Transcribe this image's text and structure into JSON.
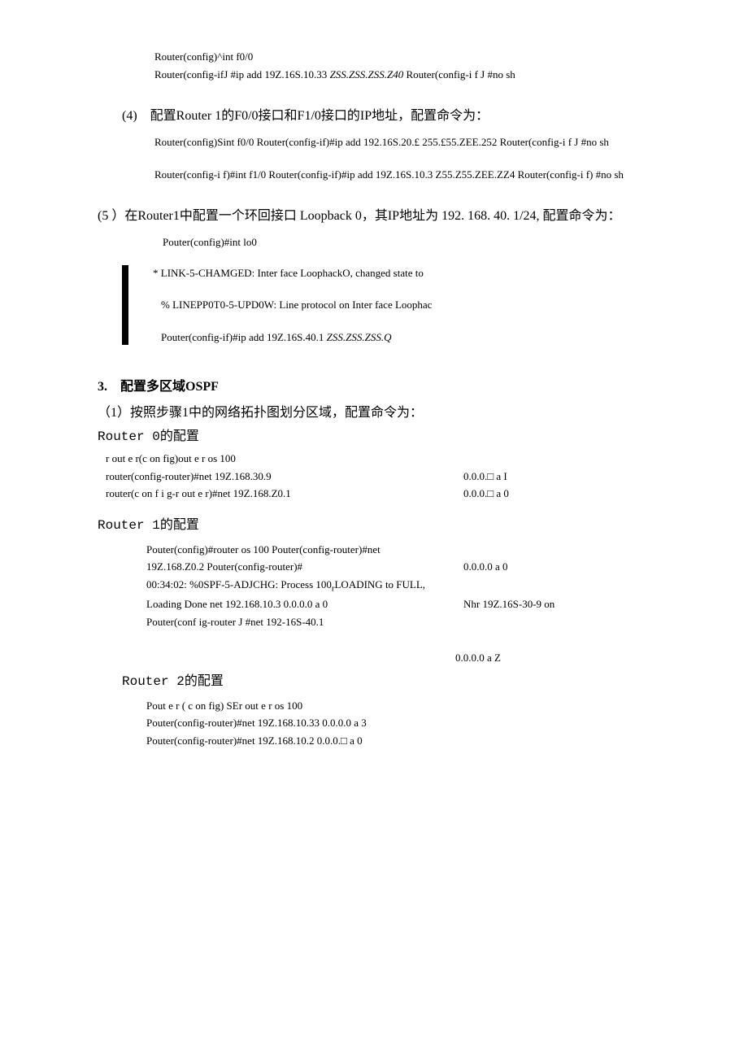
{
  "preamble": {
    "line1_a": "Router(config)^int f0/0",
    "line2_a": "Router(config-ifJ #ip add 19Z.16S.10.33 ",
    "line2_b": "ZSS.ZSS.ZSS.Z40",
    "line2_c": " Router(config-i f J #no sh"
  },
  "step4": {
    "heading": "(4)　配置Router 1的F0/0接口和F1/0接口的IP地址，配置命令为：",
    "line1": "Router(config)Sint f0/0 Router(config-if)#ip add 192.16S.20.£ 255.£55.ZEE.252 Router(config-i f J #no sh",
    "line2": "Router(config-i f)#int f1/0 Router(config-if)#ip add 19Z.16S.10.3 Z55.Z55.ZEE.ZZ4 Router(config-i f) #no sh"
  },
  "step5": {
    "heading": "(5 ）在Router1中配置一个环回接口 Loopback 0，其IP地址为 192. 168. 40. 1/24, 配置命令为：",
    "line1": "Pouter(config)#int lo0",
    "blk_line1": "* LINK-5-CHAMGED: Inter face LoophackO, changed state to",
    "blk_line2": "% LINEPP0T0-5-UPD0W: Line protocol on Inter face Loophac",
    "blk_line3_a": "Pouter(config-if)#ip add 19Z.16S.40.1 ",
    "blk_line3_b": "ZSS.ZSS.ZSS.Q"
  },
  "section3": {
    "heading": "3.　配置多区域OSPF",
    "sub1": "（1）按照步骤1中的网络拓扑图划分区域，配置命令为：",
    "r0_label": "Router 0的配置",
    "r0_line1": "r out e r(c on fig)out e r os 100",
    "r0_line2_l": "router(config-router)#net 19Z.168.30.9",
    "r0_line2_r": "0.0.0.□ a I",
    "r0_line3_l": "router(c on f i g-r out e r)#net 19Z.168.Z0.1",
    "r0_line3_r": "0.0.0.□ a 0",
    "r1_label": "Router 1的配置",
    "r1_line1": "Pouter(config)#router os 100 Pouter(config-router)#net",
    "r1_line2_l": "19Z.168.Z0.2 Pouter(config-router)#",
    "r1_line2_r": "0.0.0.0 a 0",
    "r1_line3_l": "00:34:02: %0SPF-5-ADJCHG: Process 100",
    "r1_line3_m": "r",
    "r1_line3_r": "LOADING to FULL,",
    "r1_line4_l": "Loading Done net 192.168.10.3 0.0.0.0 a 0",
    "r1_line4_r": "Nhr 19Z.16S-30-9 on",
    "r1_line5": "Pouter(conf ig-router J #net 192-16S-40.1",
    "r1_line6_r": "0.0.0.0 a Z",
    "r2_label": "Router 2的配置",
    "r2_line1": "Pout e r ( c on fig) SEr out e r os 100",
    "r2_line2": "Pouter(config-router)#net 19Z.168.10.33 0.0.0.0 a 3",
    "r2_line3": "Pouter(config-router)#net 19Z.168.10.2 0.0.0.□ a 0"
  }
}
